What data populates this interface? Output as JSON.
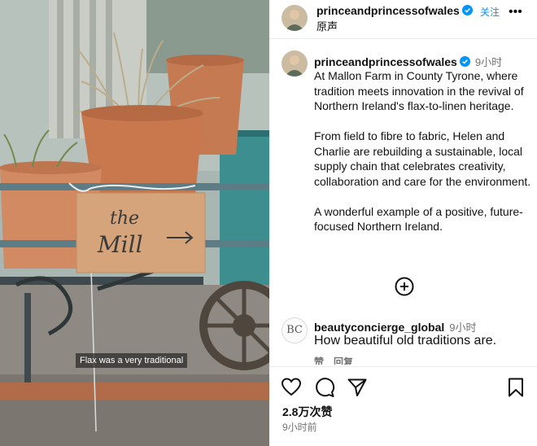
{
  "media": {
    "sign_line1": "the",
    "sign_line2": "Mill",
    "caption": "Flax was a very traditional"
  },
  "header": {
    "username": "princeandprincessofwales",
    "follow_label": "关注",
    "more_label": "•••",
    "subtitle": "原声"
  },
  "post": {
    "username": "princeandprincessofwales",
    "time": "9小时",
    "paragraphs": [
      "At Mallon Farm in County Tyrone, where tradition meets innovation in the revival of Northern Ireland's flax-to-linen heritage.",
      "From field to fibre to fabric, Helen and Charlie are rebuilding a sustainable, local supply chain that celebrates creativity, collaboration and care for the environment.",
      "A wonderful example of a positive, future-focused Northern Ireland."
    ]
  },
  "comment": {
    "avatar_text": "BC",
    "username": "beautyconcierge_global",
    "time": "9小时",
    "text": "How beautiful old traditions are.",
    "like_label": "赞",
    "reply_label": "回复"
  },
  "footer": {
    "likes": "2.8万次赞",
    "ago": "9小时前"
  },
  "colors": {
    "accent": "#0095f6",
    "verified": "#0095f6",
    "muted": "#737373"
  }
}
